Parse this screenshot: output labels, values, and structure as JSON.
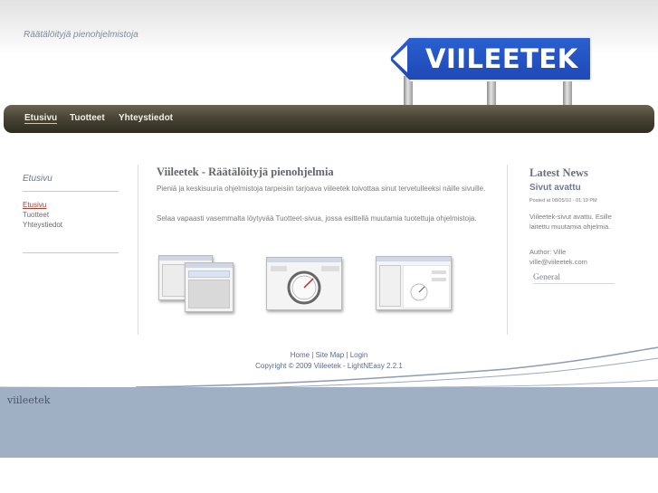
{
  "header": {
    "tagline": "Räätälöityjä pienohjelmistoja",
    "sign_text": "VIILEETEK"
  },
  "nav": {
    "items": [
      {
        "label": "Etusivu",
        "active": true
      },
      {
        "label": "Tuotteet",
        "active": false
      },
      {
        "label": "Yhteystiedot",
        "active": false
      }
    ]
  },
  "sidebar": {
    "title": "Etusivu",
    "items": [
      {
        "label": "Etusivu",
        "active": true
      },
      {
        "label": "Tuotteet",
        "active": false
      },
      {
        "label": "Yhteystiedot",
        "active": false
      }
    ]
  },
  "main": {
    "title": "Viileetek - Räätälöityjä pienohjelmia",
    "paragraphs": [
      " Pieniä ja keskisuuria ohjelmistoja tarpeisiin tarjoava viileetek toivottaa sinut tervetulleeksi näille sivuille.",
      "Selaa vapaasti vasemmalta löytyvää Tuotteet-sivua, jossa esittellä muutamia tuotettuja ohjelmistoja."
    ]
  },
  "news": {
    "heading": "Latest News",
    "post_title": "Sivut avattu",
    "posted": "Posted at 08/05/10 - 01:19 PM",
    "body": "Viileetek-sivut avattu. Esille laitettu muutamia ohjelmia.",
    "author": "Author: Ville ville@viileetek.com",
    "category": "General"
  },
  "footer": {
    "links": [
      "Home",
      "Site Map",
      "Login"
    ],
    "separator": " | ",
    "copyright": "Copyright © 2009 Viileetek - LightNEasy 2.2.1",
    "brand": "viileetek"
  },
  "colors": {
    "nav_bg": "#4a4536",
    "sign_blue": "#2b5fd0",
    "bottom_band": "#9fb0c5",
    "active_link": "#b23a2a"
  }
}
